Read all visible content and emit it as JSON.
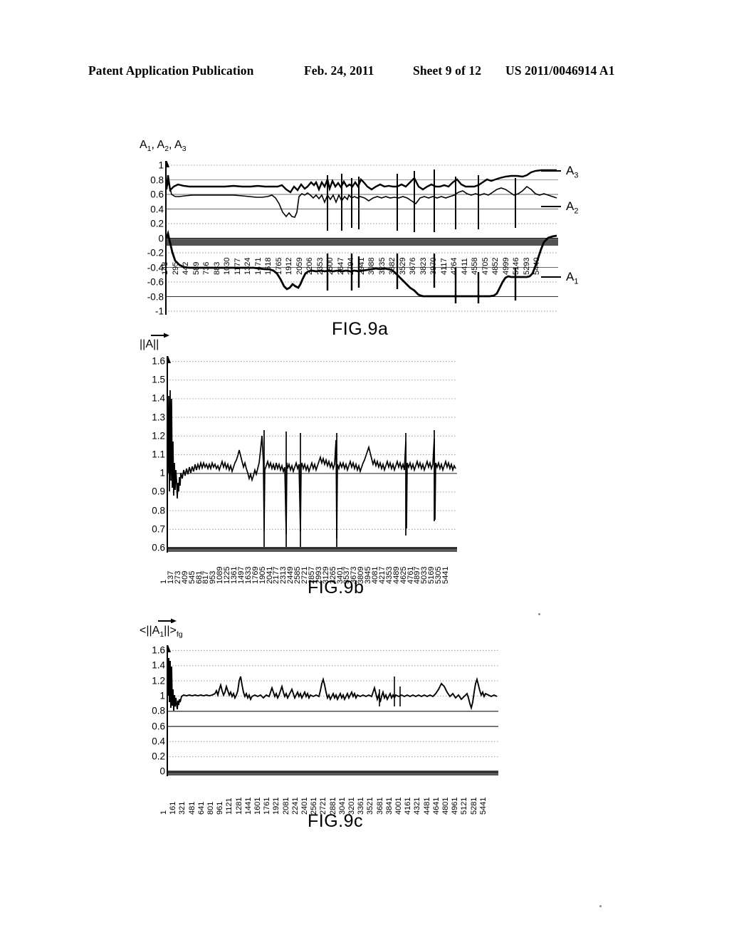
{
  "header": {
    "publication": "Patent Application Publication",
    "date": "Feb. 24, 2011",
    "sheet": "Sheet 9 of 12",
    "patent_number": "US 2011/0046914 A1"
  },
  "figures": [
    {
      "id": "fig9a",
      "caption": "FIG.9a",
      "axis_title": "A1, A2, A3",
      "curve_labels": [
        "A3",
        "A2",
        "A1"
      ],
      "chart_data": {
        "type": "line",
        "title": "FIG.9a",
        "ylabel": "A1, A2, A3",
        "xlabel": "",
        "ylim": [
          -1,
          1
        ],
        "ytick_labels": [
          "1",
          "0.8",
          "0.6",
          "0.4",
          "0.2",
          "0",
          "-0.2",
          "-0.4",
          "-0.6",
          "-0.8",
          "-1"
        ],
        "yticks": [
          1,
          0.8,
          0.6,
          0.4,
          0.2,
          0,
          -0.2,
          -0.4,
          -0.6,
          -0.8,
          -1
        ],
        "xtick_labels": [
          "148",
          "295",
          "442",
          "589",
          "736",
          "883",
          "1030",
          "1177",
          "1324",
          "1471",
          "1618",
          "1765",
          "1912",
          "2059",
          "2206",
          "2353",
          "2500",
          "2647",
          "2794",
          "2941",
          "3088",
          "3235",
          "3382",
          "3529",
          "3676",
          "3823",
          "3970",
          "4117",
          "4264",
          "4411",
          "4558",
          "4705",
          "4852",
          "4999",
          "5146",
          "5293",
          "5440"
        ],
        "grid": true,
        "legend": "right-inline",
        "series": [
          {
            "name": "A3",
            "values": [
              0.7,
              0.86,
              0.7,
              0.72,
              0.73,
              0.72,
              0.71,
              0.71,
              0.7,
              0.7,
              0.7,
              0.71,
              0.7,
              0.7,
              0.71,
              0.7,
              0.7,
              0.7,
              0.71,
              0.7,
              0.66,
              0.7,
              0.63,
              0.68,
              0.66,
              0.67,
              0.65,
              0.7,
              0.68,
              0.7,
              0.72,
              0.66,
              0.7,
              0.72,
              0.68,
              0.7,
              0.69,
              0.68,
              0.7,
              0.72,
              0.66,
              0.7,
              0.69,
              0.7,
              0.78,
              0.76,
              0.7,
              0.68,
              0.72,
              0.7,
              0.69,
              0.7,
              0.72,
              0.7,
              0.66,
              0.68,
              0.72,
              0.76,
              0.8,
              0.82,
              0.8,
              0.81,
              0.86,
              0.87
            ]
          },
          {
            "name": "A2",
            "values": [
              0.72,
              0.62,
              0.58,
              0.6,
              0.61,
              0.61,
              0.61,
              0.61,
              0.6,
              0.6,
              0.6,
              0.6,
              0.59,
              0.58,
              0.58,
              0.58,
              0.6,
              0.62,
              0.52,
              0.4,
              0.36,
              0.37,
              0.35,
              0.6,
              0.62,
              0.6,
              0.61,
              0.62,
              0.56,
              0.6,
              0.58,
              0.6,
              0.55,
              0.58,
              0.6,
              0.58,
              0.57,
              0.58,
              0.6,
              0.57,
              0.56,
              0.58,
              0.58,
              0.58,
              0.56,
              0.59,
              0.58,
              0.58,
              0.56,
              0.6,
              0.62,
              0.6,
              0.58,
              0.58,
              0.62,
              0.66,
              0.64,
              0.62,
              0.6,
              0.58,
              0.6,
              0.65,
              0.58,
              0.56
            ]
          },
          {
            "name": "A1",
            "values": [
              0.0,
              -0.06,
              -0.3,
              -0.38,
              -0.4,
              -0.41,
              -0.41,
              -0.41,
              -0.41,
              -0.41,
              -0.41,
              -0.41,
              -0.41,
              -0.42,
              -0.43,
              -0.45,
              -0.52,
              -0.62,
              -0.7,
              -0.69,
              -0.66,
              -0.68,
              -0.62,
              -0.5,
              -0.46,
              -0.46,
              -0.46,
              -0.46,
              -0.45,
              -0.46,
              -0.45,
              -0.46,
              -0.47,
              -0.45,
              -0.44,
              -0.46,
              -0.44,
              -0.45,
              -0.48,
              -0.56,
              -0.62,
              -0.7,
              -0.78,
              -0.79,
              -0.79,
              -0.79,
              -0.79,
              -0.79,
              -0.79,
              -0.79,
              -0.8,
              -0.79,
              -0.79,
              -0.79,
              -0.78,
              -0.72,
              -0.58,
              -0.5,
              -0.49,
              -0.5,
              -0.5,
              -0.44,
              -0.12,
              0.02
            ]
          }
        ],
        "spikes_note": "Sharp full-height vertical transition artifacts at several x positions"
      }
    },
    {
      "id": "fig9b",
      "caption": "FIG.9b",
      "axis_title": "||A||",
      "axis_title_has_vector_arrow": true,
      "chart_data": {
        "type": "line",
        "title": "FIG.9b",
        "ylabel": "||A||",
        "xlabel": "",
        "ylim": [
          0.6,
          1.6
        ],
        "ytick_labels": [
          "1.6",
          "1.5",
          "1.4",
          "1.3",
          "1.2",
          "1.1",
          "1",
          "0.9",
          "0.8",
          "0.7",
          "0.6"
        ],
        "yticks": [
          1.6,
          1.5,
          1.4,
          1.3,
          1.2,
          1.1,
          1.0,
          0.9,
          0.8,
          0.7,
          0.6
        ],
        "xtick_labels": [
          "1",
          "137",
          "273",
          "409",
          "545",
          "681",
          "817",
          "953",
          "1089",
          "1225",
          "1361",
          "1497",
          "1633",
          "1769",
          "1905",
          "2041",
          "2177",
          "2313",
          "2449",
          "2585",
          "2721",
          "2857",
          "2993",
          "3129",
          "3265",
          "3401",
          "3537",
          "3673",
          "3809",
          "3945",
          "4081",
          "4217",
          "4353",
          "4489",
          "4625",
          "4761",
          "4897",
          "5033",
          "5169",
          "5305",
          "5441"
        ],
        "grid": true,
        "series": [
          {
            "name": "||A||",
            "values": [
              1.0,
              1.45,
              0.92,
              1.1,
              0.95,
              1.0,
              1.02,
              1.04,
              1.03,
              1.05,
              1.04,
              1.06,
              1.05,
              1.04,
              1.06,
              1.05,
              1.04,
              1.05,
              1.08,
              1.16,
              1.06,
              1.03,
              1.0,
              1.04,
              1.2,
              0.66,
              1.08,
              1.04,
              0.66,
              1.05,
              1.06,
              0.65,
              1.07,
              1.05,
              1.04,
              1.06,
              1.22,
              0.64,
              1.05,
              1.06,
              1.04,
              1.05,
              1.08,
              1.18,
              1.05,
              1.02,
              1.06,
              1.22,
              0.88,
              1.05,
              1.04
            ]
          }
        ]
      }
    },
    {
      "id": "fig9c",
      "caption": "FIG.9c",
      "axis_title": "<||A1||>fg",
      "axis_title_has_vector_arrow": true,
      "chart_data": {
        "type": "line",
        "title": "FIG.9c",
        "ylabel": "<||A1||>fg",
        "xlabel": "",
        "ylim": [
          0,
          1.6
        ],
        "ytick_labels": [
          "1.6",
          "1.4",
          "1.2",
          "1",
          "0.8",
          "0.6",
          "0.4",
          "0.2",
          "0"
        ],
        "yticks": [
          1.6,
          1.4,
          1.2,
          1.0,
          0.8,
          0.6,
          0.4,
          0.2,
          0
        ],
        "xtick_labels": [
          "1",
          "161",
          "321",
          "481",
          "641",
          "801",
          "961",
          "1121",
          "1281",
          "1441",
          "1601",
          "1761",
          "1921",
          "2081",
          "2241",
          "2401",
          "2561",
          "2721",
          "2881",
          "3041",
          "3201",
          "3361",
          "3521",
          "3681",
          "3841",
          "4001",
          "4161",
          "4321",
          "4481",
          "4641",
          "4801",
          "4961",
          "5121",
          "5281",
          "5441"
        ],
        "grid": true,
        "series": [
          {
            "name": "<||A1||>fg",
            "values": [
              1.0,
              1.45,
              0.9,
              1.02,
              1.0,
              1.01,
              1.01,
              1.0,
              1.02,
              1.06,
              1.1,
              1.02,
              1.05,
              1.16,
              1.02,
              1.0,
              1.01,
              1.03,
              1.0,
              1.02,
              1.06,
              1.01,
              1.03,
              1.0,
              1.02,
              1.08,
              0.98,
              1.02,
              1.04,
              1.02,
              1.0,
              1.05,
              1.0,
              1.18,
              0.96,
              1.02,
              1.0,
              1.01,
              1.0,
              1.02,
              1.08,
              1.0,
              1.02,
              0.92,
              1.08,
              1.02,
              1.0,
              1.02
            ]
          }
        ]
      }
    }
  ]
}
